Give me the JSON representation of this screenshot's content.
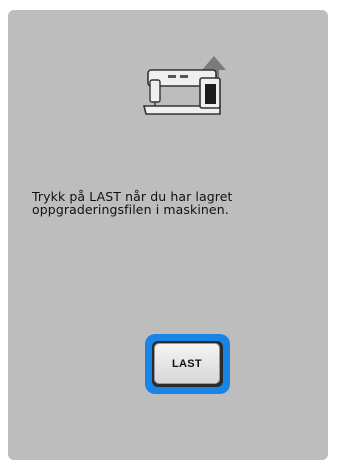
{
  "screen": {
    "background": "#bdbdbd",
    "icon": "sewing-machine-upgrade-icon",
    "message": "Trykk på LAST når du har lagret\noppgraderingsfilen i maskinen."
  },
  "load_button": {
    "label": "LAST",
    "highlight_color": "#1a84e6"
  }
}
